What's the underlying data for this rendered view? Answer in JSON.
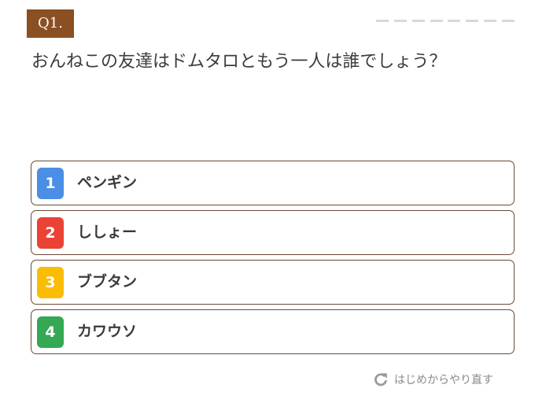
{
  "question": {
    "number_label": "Q1.",
    "text": "おんねこの友達はドムタロともう一人は誰でしょう？"
  },
  "progress": {
    "total_steps": 8
  },
  "choices": [
    {
      "number": "1",
      "label": "ペンギン",
      "color": "#4a8ee6"
    },
    {
      "number": "2",
      "label": "ししょー",
      "color": "#ea4335"
    },
    {
      "number": "3",
      "label": "ブブタン",
      "color": "#fbbc05"
    },
    {
      "number": "4",
      "label": "カワウソ",
      "color": "#34a853"
    }
  ],
  "restart": {
    "label": "はじめからやり直す",
    "icon": "refresh-icon"
  },
  "colors": {
    "badge": "#8a4f22",
    "choice_border": "#6b4a36",
    "dash": "#d9d9d9"
  }
}
